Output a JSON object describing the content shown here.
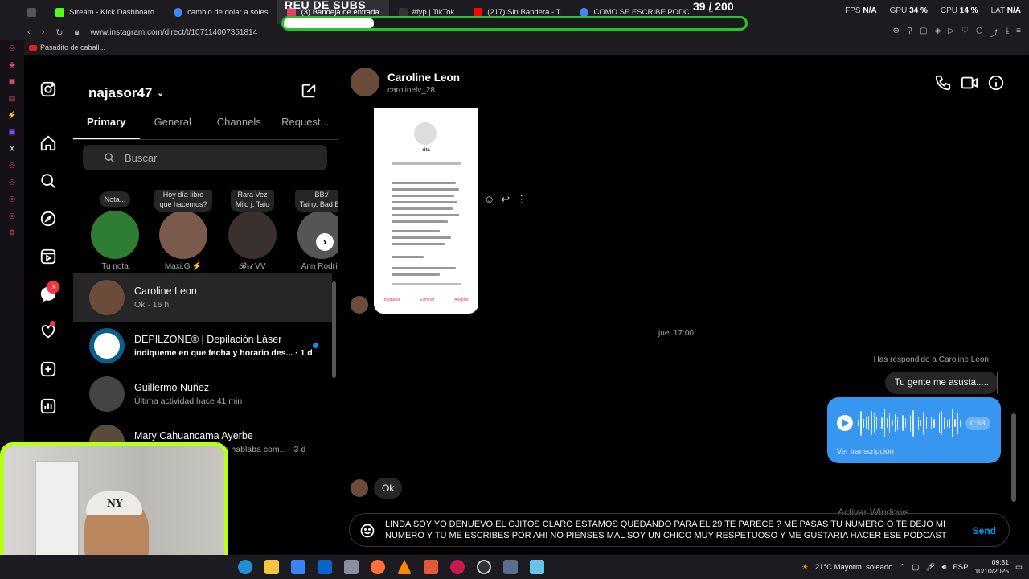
{
  "browser": {
    "tabs": [
      {
        "label": "",
        "color": "#555"
      },
      {
        "label": "Stream - Kick Dashboard",
        "color": "#53fc18"
      },
      {
        "label": "cambio de dolar a soles",
        "color": "#4285f4"
      },
      {
        "label": "(3) Bandeja de entrada",
        "color": "#e4405f"
      },
      {
        "label": "#fyp | TikTok",
        "color": "#333"
      },
      {
        "label": "(217) Sin Bandera - T",
        "color": "#ff0000"
      },
      {
        "label": "COMO SE ESCRIBE PODC",
        "color": "#4285f4"
      }
    ],
    "url": "www.instagram.com/direct/t/107114007351814",
    "bookmark": "Pasadito de caball...",
    "sysmon": [
      {
        "label": "FPS",
        "value": "N/A"
      },
      {
        "label": "GPU",
        "value": "34 %"
      },
      {
        "label": "CPU",
        "value": "14 %"
      },
      {
        "label": "LAT",
        "value": "N/A"
      }
    ]
  },
  "overlay": {
    "title": "REU DE SUBS",
    "count": "39   / 200",
    "progress_fraction": 0.195
  },
  "rail": {
    "messages_badge": "3"
  },
  "inbox": {
    "username": "najasor47",
    "tabs": [
      "Primary",
      "General",
      "Channels",
      "Request..."
    ],
    "search_placeholder": "Buscar",
    "notes": [
      {
        "bubble": "Nota...",
        "name": "Tu nota",
        "color": "#2e7d32"
      },
      {
        "bubble": "Hoy día libre\nque hacemos?",
        "name": "Maxi.Gi⚡",
        "color": "#7a5a4a"
      },
      {
        "bubble": "Rara Vez\nMilo j, Taiu",
        "name": "𝓑𝓻𝓲 VV",
        "color": "#3a3030"
      },
      {
        "bubble": "BB:/\nTainy, Bad Bu",
        "name": "Ann Rodríg",
        "color": "#555"
      }
    ],
    "threads": [
      {
        "name": "Caroline Leon",
        "sub": "Ok · 16 h",
        "unread": false,
        "color": "#6b4c3b"
      },
      {
        "name": "DEPILZONE® | Depilación Láser",
        "sub": "indiqueme en que fecha y horario des... · 1 d",
        "unread": true,
        "color": "#0a5e8a"
      },
      {
        "name": "Guillermo Nuñez",
        "sub": "Última actividad hace 41 min",
        "unread": false,
        "color": "#444"
      },
      {
        "name": "Mary Cahuancama Ayerbe",
        "sub": "que hablaba com... · 3 d",
        "unread": false,
        "color": "#5a4a3a"
      }
    ]
  },
  "conversation": {
    "name": "Caroline Leon",
    "username": "carolinelv_28",
    "shared_post": {
      "profile": "rita",
      "buttons": [
        "Bloquear",
        "Eliminar",
        "Aceptar"
      ]
    },
    "timestamp": "jue, 17:00",
    "replied_label": "Has respondido a Caroline Leon",
    "quote": "Tu gente me asusta.....",
    "voice": {
      "duration": "0:53",
      "transcript": "Ver transcripción"
    },
    "ok_message": "Ok",
    "draft": "LINDA SOY YO DENUEVO EL OJITOS CLARO ESTAMOS QUEDANDO PARA EL 29 TE PARECE ? ME PASAS TU NUMERO O TE DEJO MI NUMERO Y TU ME ESCRIBES POR AHI NO PIENSES MAL SOY UN CHICO MUY RESPETUOSO Y ME GUSTARIA HACER ESE PODCAST",
    "send_label": "Send",
    "watermark": "Activar Windows"
  },
  "taskbar": {
    "weather": "21°C  Mayorm. soleado",
    "lang": "ESP",
    "time": "09:31",
    "date": "10/10/2025"
  }
}
